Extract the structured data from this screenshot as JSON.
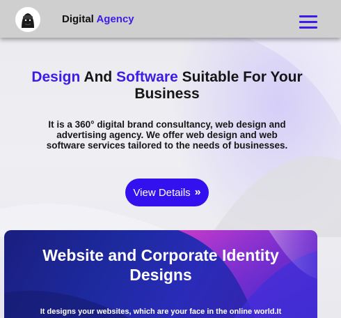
{
  "header": {
    "brand_primary": "Digital",
    "brand_accent": "Agency",
    "logo_icon": "gorilla-logo-icon",
    "menu_icon": "hamburger-menu-icon"
  },
  "hero": {
    "title_accent_1": "Design",
    "title_mid": " And ",
    "title_accent_2": "Software",
    "title_rest": " Suitable For Your Business",
    "description": "It is a 360° digital brand consultancy, web design and advertising agency. We offer web design and web software services tailored to the needs of businesses.",
    "cta_label": "View Details",
    "cta_icon": "double-chevron-right-icon"
  },
  "card": {
    "title": "Website and Corporate Identity Designs",
    "text": "It designs your websites, which are your face in the online world.It"
  },
  "colors": {
    "accent": "#3d1ce6",
    "button": "#3211ee",
    "header_bg": "#cfcfcf",
    "card_bg": "#1d2aa0"
  }
}
